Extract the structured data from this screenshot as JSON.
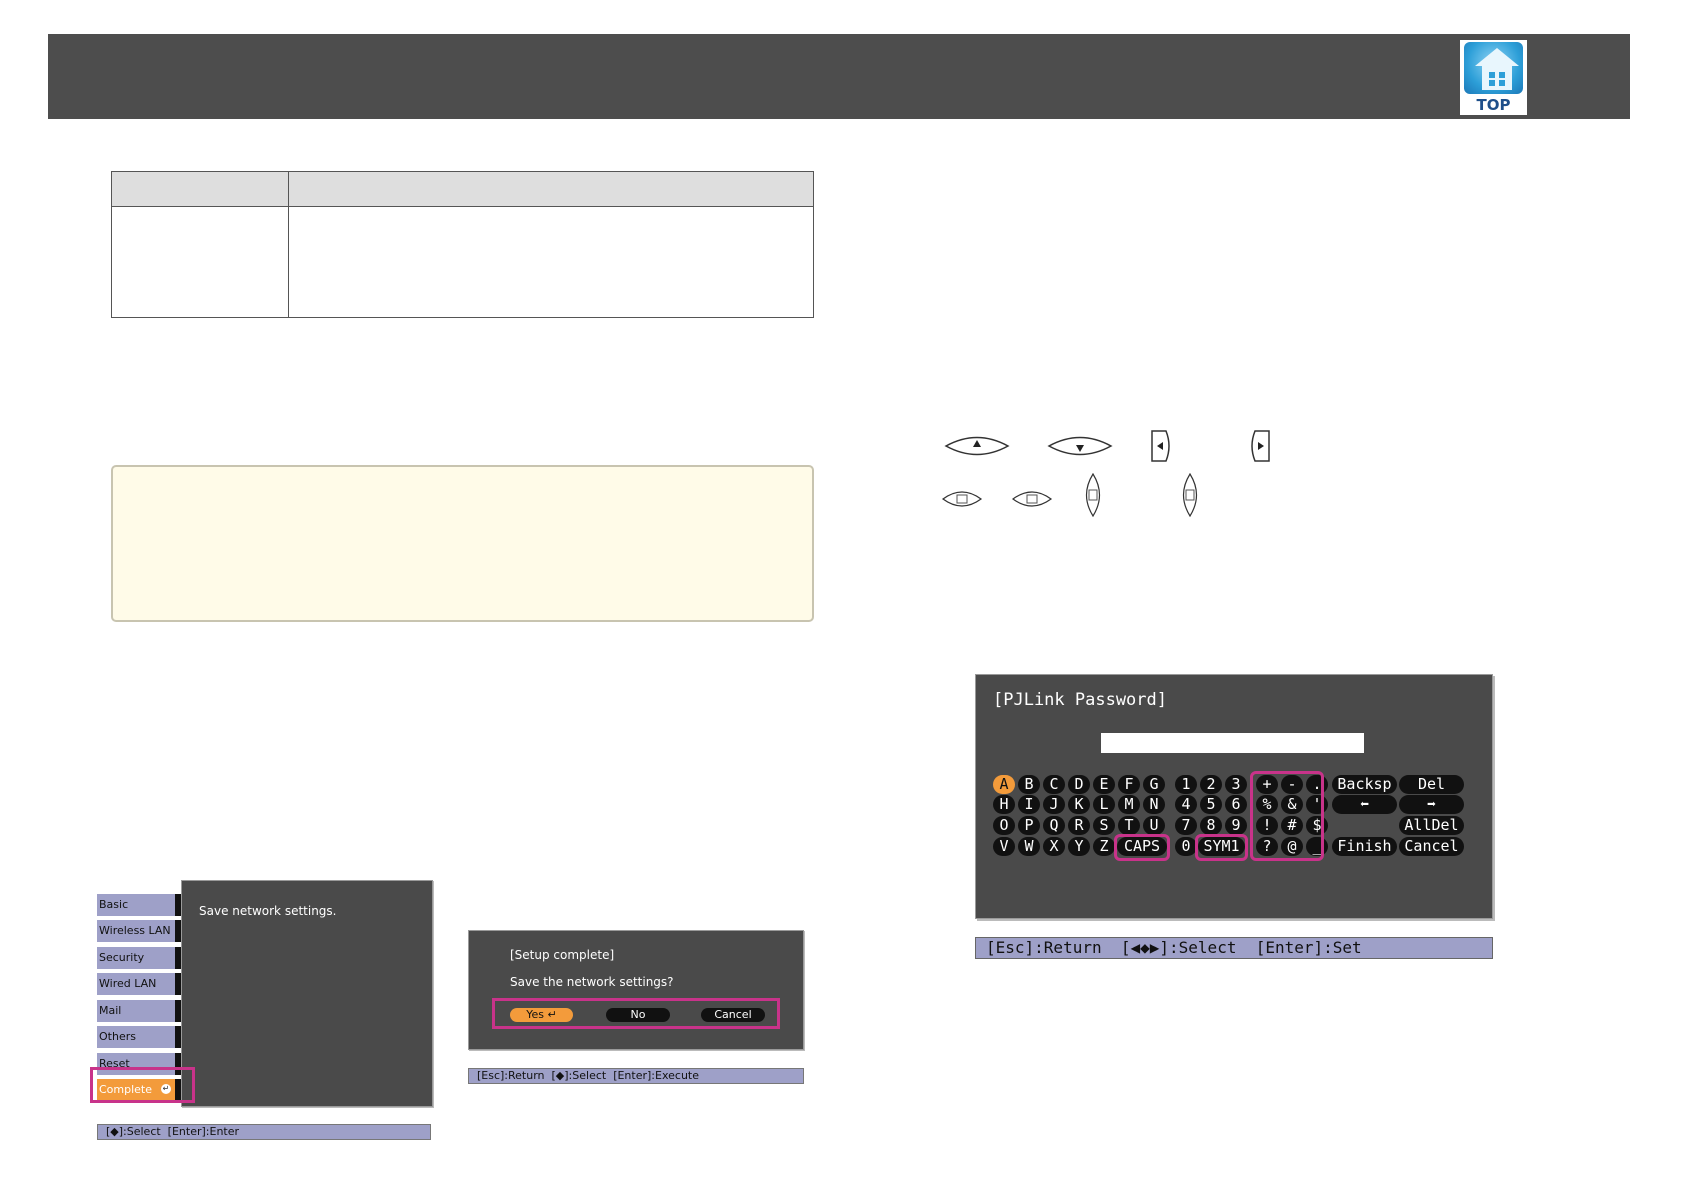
{
  "header": {
    "top_link_label": "TOP",
    "top_icon": "home-icon"
  },
  "remote_buttons": {
    "row1": [
      "up-arrow-button-icon",
      "down-arrow-button-icon",
      "left-arrow-button-icon",
      "right-arrow-button-icon"
    ],
    "row2": [
      "up-button-icon",
      "down-button-icon",
      "left-button-icon",
      "right-button-icon"
    ]
  },
  "network_menu": {
    "items": [
      "Basic",
      "Wireless LAN",
      "Security",
      "Wired LAN",
      "Mail",
      "Others",
      "Reset",
      "Complete"
    ],
    "selected": "Complete",
    "message": "Save network settings.",
    "status": "[◆]:Select  [Enter]:Enter"
  },
  "setup_dialog": {
    "title": "[Setup complete]",
    "question": "Save the network settings?",
    "buttons": [
      "Yes",
      "No",
      "Cancel"
    ],
    "selected": "Yes",
    "status": "[Esc]:Return  [◆]:Select  [Enter]:Execute"
  },
  "pjlink_keyboard": {
    "title": "[PJLink Password]",
    "field_value": "",
    "rows": [
      [
        "A",
        "B",
        "C",
        "D",
        "E",
        "F",
        "G",
        "1",
        "2",
        "3",
        "+",
        "-",
        "."
      ],
      [
        "H",
        "I",
        "J",
        "K",
        "L",
        "M",
        "N",
        "4",
        "5",
        "6",
        "%",
        "&",
        "'"
      ],
      [
        "O",
        "P",
        "Q",
        "R",
        "S",
        "T",
        "U",
        "7",
        "8",
        "9",
        "!",
        "#",
        "$"
      ],
      [
        "V",
        "W",
        "X",
        "Y",
        "Z",
        "CAPS",
        "0",
        "SYM1",
        "?",
        "@",
        "_"
      ]
    ],
    "commands": {
      "backsp": "Backsp",
      "del": "Del",
      "left": "⬅",
      "right": "➡",
      "alldel": "AllDel",
      "finish": "Finish",
      "cancel": "Cancel"
    },
    "selected_key": "A",
    "status": "[Esc]:Return  [◀◆▶]:Select  [Enter]:Set"
  }
}
